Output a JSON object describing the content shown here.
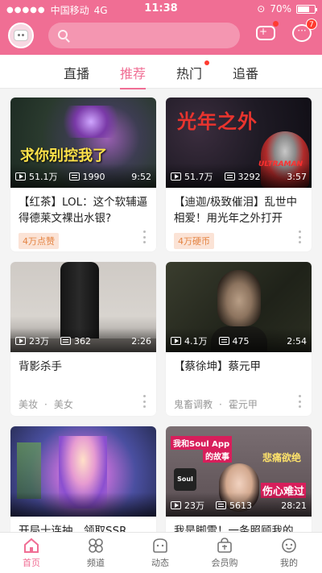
{
  "status_bar": {
    "carrier": "中国移动",
    "network": "4G",
    "time": "11:38",
    "battery": "70%",
    "battery_level": 0.7
  },
  "header": {
    "message_badge": "7",
    "msg_icon_glyph": "···"
  },
  "tabs": [
    {
      "label": "直播",
      "active": false
    },
    {
      "label": "推荐",
      "active": true
    },
    {
      "label": "热门",
      "active": false,
      "dot": true
    },
    {
      "label": "追番",
      "active": false
    }
  ],
  "cards": [
    {
      "thumb_text": "求你别控我了",
      "views": "51.1万",
      "danmaku": "1990",
      "duration": "9:52",
      "title": "【红茶】LOL：这个软辅逼得德莱文裸出水银?",
      "tag": "4万点赞",
      "tags": []
    },
    {
      "thumb_text": "光年之外",
      "thumb_subtext": "ULTRAMAN",
      "views": "51.7万",
      "danmaku": "3292",
      "duration": "3:57",
      "title": "【迪迦/极致催泪】乱世中相爱！用光年之外打开爱…",
      "tag": "4万硬币",
      "tags": []
    },
    {
      "views": "23万",
      "danmaku": "362",
      "duration": "2:26",
      "title": "背影杀手",
      "tag": "",
      "tags": [
        "美妆",
        "美女"
      ]
    },
    {
      "views": "4.1万",
      "danmaku": "475",
      "duration": "2:54",
      "title": "【蔡徐坤】蔡元甲",
      "tag": "",
      "tags": [
        "鬼畜调教",
        "霍元甲"
      ]
    },
    {
      "views": "",
      "danmaku": "",
      "duration": "",
      "title": "开局十连抽，领取SSR",
      "tag": "",
      "tags": []
    },
    {
      "thumb_lines": [
        "我和Soul App",
        "的故事",
        "悲痛欲绝",
        "伤心难过",
        "Soul"
      ],
      "views": "23万",
      "danmaku": "5613",
      "duration": "28:21",
      "title": "我是脚雷！一条照顾我的",
      "tag": "",
      "tags": []
    }
  ],
  "tag_separator": "·",
  "bottom_nav": [
    {
      "label": "首页",
      "icon": "home-icon",
      "active": true
    },
    {
      "label": "频道",
      "icon": "channel-icon",
      "active": false
    },
    {
      "label": "动态",
      "icon": "moments-icon",
      "active": false
    },
    {
      "label": "会员购",
      "icon": "shop-icon",
      "active": false
    },
    {
      "label": "我的",
      "icon": "profile-icon",
      "active": false
    }
  ],
  "colors": {
    "accent": "#f06e94",
    "tag_bg": "#fbe3d6",
    "tag_text": "#e48443"
  }
}
